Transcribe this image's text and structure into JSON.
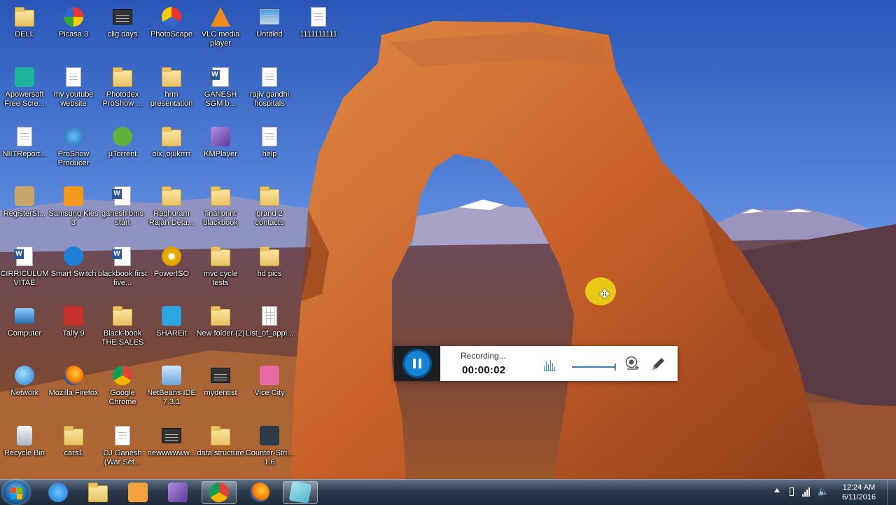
{
  "desktop": {
    "icons": [
      {
        "label": "DELL",
        "icon": "folder-icon"
      },
      {
        "label": "Picasa 3",
        "icon": "picasa-icon"
      },
      {
        "label": "clig days",
        "icon": "video-file-icon"
      },
      {
        "label": "PhotoScape",
        "icon": "photoscape-icon"
      },
      {
        "label": "VLC media player",
        "icon": "vlc-icon"
      },
      {
        "label": "Untitled",
        "icon": "image-file-icon"
      },
      {
        "label": "1111111111",
        "icon": "text-file-icon"
      },
      {
        "label": "Apowersoft Free Scre...",
        "icon": "apowersoft-icon"
      },
      {
        "label": "my youtube website",
        "icon": "text-file-icon"
      },
      {
        "label": "Photodex ProShow ...",
        "icon": "folder-icon"
      },
      {
        "label": "hrm presentation",
        "icon": "folder-icon"
      },
      {
        "label": "GANESH SGM b...",
        "icon": "word-doc-icon"
      },
      {
        "label": "rajiv gandhi hospitals",
        "icon": "text-file-icon"
      },
      {
        "label": "NIITReport...",
        "icon": "text-file-icon"
      },
      {
        "label": "ProShow Producer",
        "icon": "proshow-icon"
      },
      {
        "label": "µTorrent",
        "icon": "utorrent-icon"
      },
      {
        "label": "olx,,ojukrrrr",
        "icon": "folder-icon"
      },
      {
        "label": "KMPlayer",
        "icon": "kmplayer-icon"
      },
      {
        "label": "help",
        "icon": "text-file-icon"
      },
      {
        "label": "RegisterSt...",
        "icon": "book-icon"
      },
      {
        "label": "Samsung Kies 3",
        "icon": "samsung-kies-icon"
      },
      {
        "label": "ganesh bms start",
        "icon": "word-doc-icon"
      },
      {
        "label": "Raghuram Rajan Deta...",
        "icon": "folder-icon"
      },
      {
        "label": "final print blackbook",
        "icon": "folder-icon"
      },
      {
        "label": "grand 2 contacts",
        "icon": "folder-icon"
      },
      {
        "label": "CIRRICULUM VITAE",
        "icon": "word-doc-icon"
      },
      {
        "label": "Smart Switch",
        "icon": "smart-switch-icon"
      },
      {
        "label": "blackbook first five...",
        "icon": "word-doc-icon"
      },
      {
        "label": "PowerISO",
        "icon": "poweriso-icon"
      },
      {
        "label": "mvc cycle tests",
        "icon": "folder-icon"
      },
      {
        "label": "hd pics",
        "icon": "folder-icon"
      },
      {
        "label": "Computer",
        "icon": "computer-icon"
      },
      {
        "label": "Tally 9",
        "icon": "tally-icon"
      },
      {
        "label": "Black-book THE SALES ...",
        "icon": "folder-icon"
      },
      {
        "label": "SHAREit",
        "icon": "shareit-icon"
      },
      {
        "label": "New folder (2)",
        "icon": "folder-icon"
      },
      {
        "label": "List_of_appl...",
        "icon": "spreadsheet-icon"
      },
      {
        "label": "Network",
        "icon": "network-icon"
      },
      {
        "label": "Mozilla Firefox",
        "icon": "firefox-icon"
      },
      {
        "label": "Google Chrome",
        "icon": "chrome-icon"
      },
      {
        "label": "NetBeans IDE 7.3.1",
        "icon": "netbeans-icon"
      },
      {
        "label": "mydentist",
        "icon": "video-file-icon"
      },
      {
        "label": "Vice City",
        "icon": "vice-city-icon"
      },
      {
        "label": "Recycle Bin",
        "icon": "recycle-bin-icon"
      },
      {
        "label": "cars1",
        "icon": "folder-icon"
      },
      {
        "label": "DJ Ganesh (War Set...",
        "icon": "mp3-file-icon"
      },
      {
        "label": "newwwwww...",
        "icon": "video-file-icon"
      },
      {
        "label": "data structure",
        "icon": "folder-icon"
      },
      {
        "label": "Counter-Stri... 1.6",
        "icon": "counter-strike-icon"
      }
    ]
  },
  "recorder": {
    "status": "Recording...",
    "time": "00:00:02",
    "volume_level": 1.0
  },
  "taskbar": {
    "pinned": [
      {
        "name": "internet-explorer-icon"
      },
      {
        "name": "file-explorer-icon"
      },
      {
        "name": "media-player-icon"
      },
      {
        "name": "kmplayer-icon"
      },
      {
        "name": "chrome-icon",
        "active": true
      },
      {
        "name": "firefox-icon"
      },
      {
        "name": "recorder-app-icon",
        "active": true
      }
    ],
    "clock": {
      "time": "12:24 AM",
      "date": "6/11/2016"
    }
  },
  "colors": {
    "accent": "#1683d4",
    "taskbar": "#2b3a4b",
    "sky_top": "#2a56b8",
    "rock": "#c8612a"
  }
}
